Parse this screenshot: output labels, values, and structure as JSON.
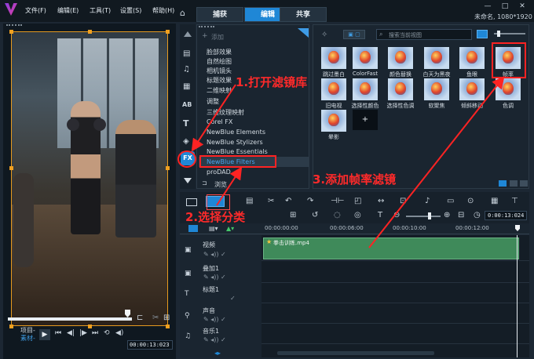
{
  "app": {
    "title_info": "未命名, 1080*1920"
  },
  "menu": [
    "文件(F)",
    "编辑(E)",
    "工具(T)",
    "设置(S)",
    "帮助(H)"
  ],
  "tabs": [
    {
      "label": "捕获",
      "active": false
    },
    {
      "label": "编辑",
      "active": true
    },
    {
      "label": "共享",
      "active": false
    }
  ],
  "library": {
    "add_label": "添加",
    "browse_label": "浏览",
    "search_placeholder": "搜索当前视图",
    "categories": [
      "脸部效果",
      "自然绘图",
      "相机镜头",
      "标题效果",
      "二维映射",
      "调整",
      "三维纹理映射",
      "Corel FX",
      "NewBlue Elements",
      "NewBlue Stylizers",
      "NewBlue Essentials",
      "NewBlue Filters",
      "proDAD"
    ],
    "selected_category": "NewBlue Filters",
    "fx_label": "FX"
  },
  "effects": [
    {
      "label": "跳过墨白"
    },
    {
      "label": "ColorFast"
    },
    {
      "label": "颜色替换"
    },
    {
      "label": "白天为黑夜"
    },
    {
      "label": "鱼眼"
    },
    {
      "label": "帧率"
    },
    {
      "label": "旧电视"
    },
    {
      "label": "选择性颜色"
    },
    {
      "label": "选择性色调"
    },
    {
      "label": "软聚焦"
    },
    {
      "label": "倾斜移动"
    },
    {
      "label": "色调"
    },
    {
      "label": "晕影"
    }
  ],
  "timeline": {
    "timecodes": [
      "00:00:00:00",
      "00:00:06:00",
      "00:00:10:00",
      "00:00:12:00"
    ],
    "current_time": "0:00:13:024",
    "tracks": [
      "视频",
      "叠加1",
      "标题1",
      "声音",
      "音乐1"
    ],
    "clip_name": "拳击训练.mp4"
  },
  "player": {
    "mode_project": "项目-",
    "mode_clip": "素材-",
    "timecode": "00:00:13:023"
  },
  "annotations": {
    "step1": "1.打开滤镜库",
    "step2": "2.选择分类",
    "step3": "3.添加帧率滤镜"
  },
  "colors": {
    "accent": "#1f87d6",
    "annotation": "#ff2323",
    "clip": "#3f8a5a",
    "selection": "#f0a020"
  }
}
